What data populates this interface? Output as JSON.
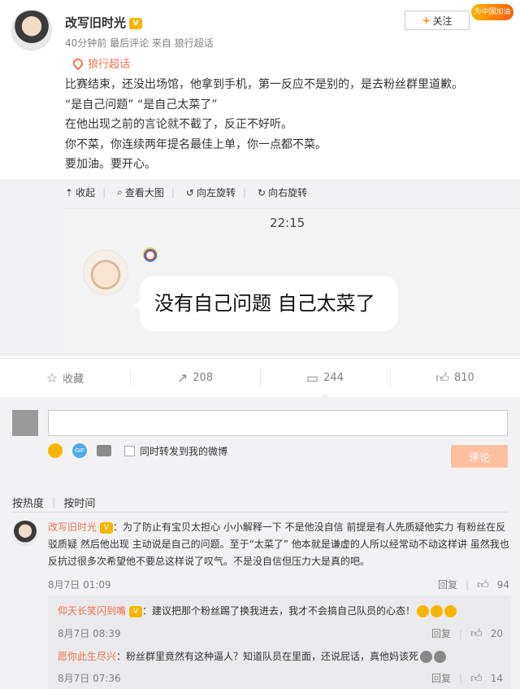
{
  "post": {
    "author": "改写旧时光",
    "meta": "40分钟前 最后评论 来自 狼行超话",
    "follow_label": "关注",
    "fan_banner": "为中国加油",
    "topic": "狼行超话",
    "text": [
      "比赛结束，还没出场馆，他拿到手机，第一反应不是别的，是去粉丝群里道歉。",
      "“是自己问题” “是自己太菜了”",
      "在他出现之前的言论就不截了，反正不好听。",
      "你不菜，你连续两年提名最佳上单，你一点都不菜。",
      "要加油。要开心。"
    ],
    "media_tools": [
      "收起",
      "查看大图",
      "向左旋转",
      "向右旋转"
    ],
    "chat": {
      "time": "22:15",
      "message": "没有自己问题  自己太菜了"
    }
  },
  "actions": {
    "collect": "收藏",
    "repost": "208",
    "comment": "244",
    "like": "810"
  },
  "composer": {
    "repost_label": "同时转发到我的微博",
    "submit_label": "评论"
  },
  "sort": {
    "hot": "按热度",
    "time": "按时间"
  },
  "comment": {
    "user": "改写旧时光",
    "text": "：为了防止有宝贝太担心 小小解释一下 不是他没自信 前提是有人先质疑他实力 有粉丝在反驳质疑 然后他出现 主动说是自己的问题。至于“太菜了” 他本就是谦虚的人所以经常动不动这样讲 虽然我也反抗过很多次希望他不要总这样说了叹气。不是没自信但压力大是真的吧。",
    "date": "8月7日 01:09",
    "reply_label": "回复",
    "likes": "94"
  },
  "replies": [
    {
      "user": "仰天长笑闪到嘴",
      "text": "：建议把那个粉丝踢了换我进去，我才不会搞自己队员的心态！",
      "date": "8月7日 08:39",
      "reply_label": "回复",
      "likes": "20"
    },
    {
      "user": "愿你此生尽兴",
      "text": "：粉丝群里竟然有这种逼人？知道队员在里面，还说屁话，真他妈该死",
      "date": "8月7日 07:36",
      "reply_label": "回复",
      "likes": "14"
    }
  ],
  "icons": [
    "vip-icon",
    "location-icon",
    "collapse-icon",
    "zoom-icon",
    "rotate-left-icon",
    "rotate-right-icon",
    "star-icon",
    "repost-icon",
    "comment-icon",
    "like-icon",
    "smile-icon",
    "gif-icon",
    "image-icon",
    "clown-icon"
  ]
}
